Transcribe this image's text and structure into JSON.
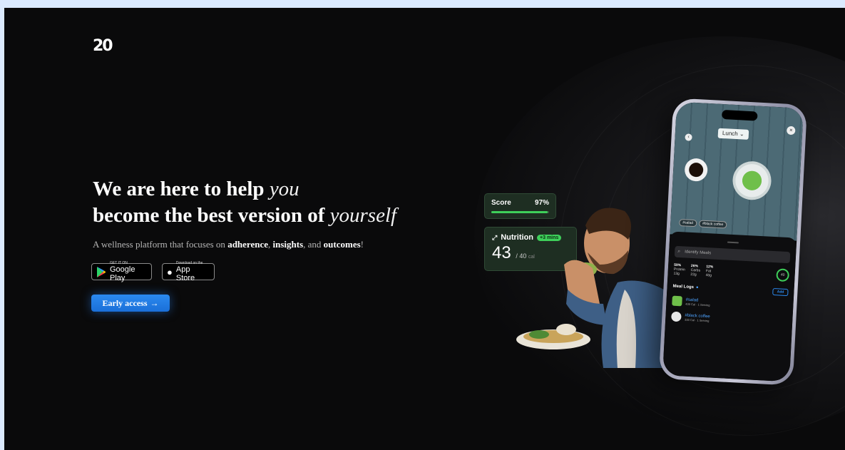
{
  "brand": {
    "logo_text": "20"
  },
  "hero": {
    "line1_bold": "We are here to help",
    "line1_italic": "you",
    "line2_bold": "become the best version of",
    "line2_italic": "yourself",
    "sub_prefix": "A wellness platform that focuses on",
    "sub_k1": "adherence",
    "sub_sep1": ",",
    "sub_k2": "insights",
    "sub_sep2": ", and",
    "sub_k3": "outcomes",
    "sub_end": "!"
  },
  "stores": {
    "google_small": "GET IT ON",
    "google_big": "Google Play",
    "apple_small": "Download on the",
    "apple_big": "App Store"
  },
  "cta": {
    "label": "Early access",
    "arrow": "→"
  },
  "score_card": {
    "label": "Score",
    "value": "97%",
    "progress": 0.97
  },
  "nutrition_card": {
    "label": "Nutrition",
    "badge": "+3 mins",
    "value": "43",
    "unit": "/ 40",
    "unit_suffix": "cal"
  },
  "phone": {
    "meal_selector": "Lunch ⌄",
    "tag1": "#salad",
    "tag2": "#black coffee",
    "search_placeholder": "Identify Meals",
    "macro1_pct": "59%",
    "macro1_name": "Protein",
    "macro1_val": "13g",
    "macro2_pct": "26%",
    "macro2_name": "Carbs",
    "macro2_val": "22g",
    "macro3_pct": "12%",
    "macro3_name": "Fat",
    "macro3_val": "40g",
    "ring_value": "40",
    "logs_title": "Meal Logs",
    "add_label": "Add",
    "item1_name": "#salad",
    "item1_meta": "430 Cal · 1 Serving",
    "item2_name": "#black coffee",
    "item2_meta": "333 Cal · 1 Serving"
  },
  "colors": {
    "accent": "#2b8af0",
    "green": "#3ecf5a",
    "background": "#0a0a0b"
  }
}
